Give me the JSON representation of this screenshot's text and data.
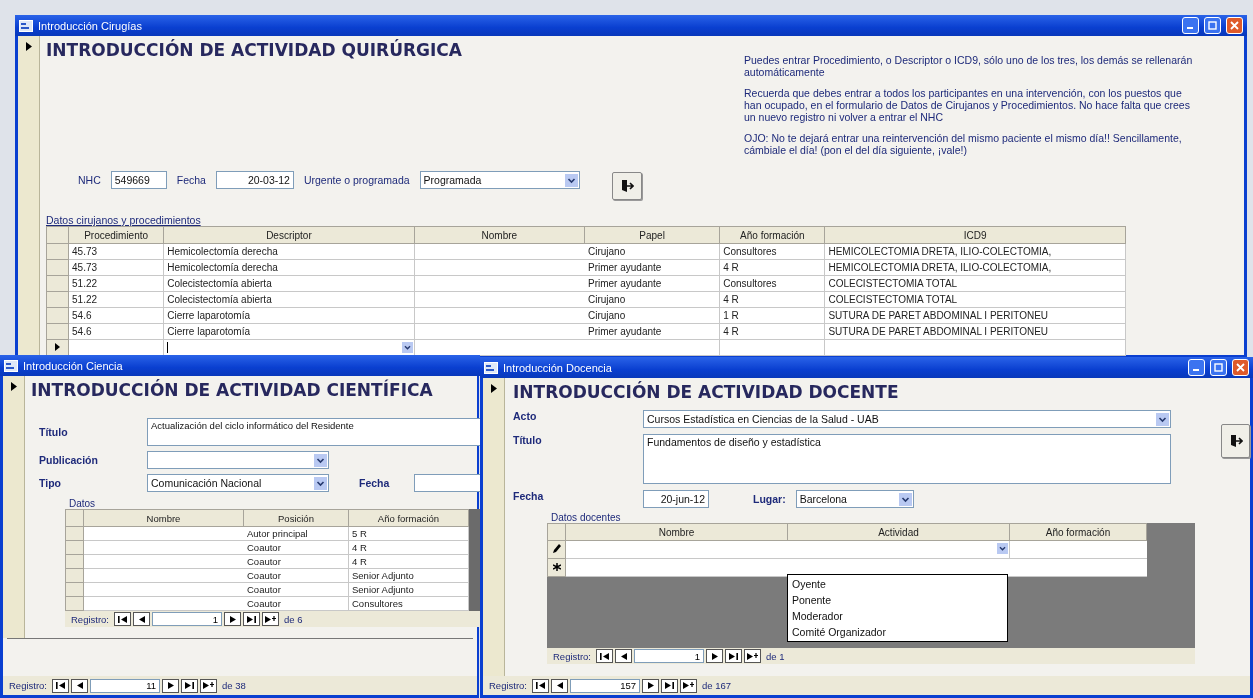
{
  "surgery_window": {
    "title": "Introducción Cirugías",
    "heading": "INTRODUCCIÓN DE ACTIVIDAD QUIRÚRGICA",
    "notes": [
      "Puedes entrar Procedimiento, o Descriptor o ICD9, sólo uno de los tres, los demás se rellenarán automáticamente",
      "Recuerda que debes entrar a todos los participantes en una intervención, con los puestos que han ocupado, en el formulario de Datos de Cirujanos y Procedimientos. No hace falta que crees un nuevo registro ni volver a entrar el NHC",
      "OJO: No te dejará entrar una reintervención del mismo paciente el mismo día!! Sencillamente, cámbiale el día! (pon el del día siguiente, ¡vale!)"
    ],
    "nhc_label": "NHC",
    "nhc": "549669",
    "date_label": "Fecha",
    "date": "20-03-12",
    "priority_label": "Urgente o programada",
    "priority": "Programada",
    "subform_label": "Datos cirujanos y procedimientos",
    "columns": [
      "Procedimiento",
      "Descriptor",
      "Nombre",
      "Papel",
      "Año formación",
      "ICD9"
    ],
    "rows": [
      {
        "procedure": "45.73",
        "descriptor": "Hemicolectomía derecha",
        "role": "Cirujano",
        "training": "Consultores",
        "icd9": "HEMICOLECTOMIA DRETA, ILIO-COLECTOMIA,"
      },
      {
        "procedure": "45.73",
        "descriptor": "Hemicolectomía derecha",
        "role": "Primer ayudante",
        "training": "4 R",
        "icd9": "HEMICOLECTOMIA DRETA, ILIO-COLECTOMIA,"
      },
      {
        "procedure": "51.22",
        "descriptor": "Colecistectomía abierta",
        "role": "Primer ayudante",
        "training": "Consultores",
        "icd9": "COLECISTECTOMIA TOTAL"
      },
      {
        "procedure": "51.22",
        "descriptor": "Colecistectomía abierta",
        "role": "Cirujano",
        "training": "4 R",
        "icd9": "COLECISTECTOMIA TOTAL"
      },
      {
        "procedure": "54.6",
        "descriptor": "Cierre laparotomía",
        "role": "Cirujano",
        "training": "1 R",
        "icd9": "SUTURA DE PARET ABDOMINAL I PERITONEU"
      },
      {
        "procedure": "54.6",
        "descriptor": "Cierre laparotomía",
        "role": "Primer ayudante",
        "training": "4 R",
        "icd9": "SUTURA DE PARET ABDOMINAL I PERITONEU"
      }
    ]
  },
  "science_window": {
    "title": "Introducción Ciencia",
    "heading": "INTRODUCCIÓN DE ACTIVIDAD CIENTÍFICA",
    "title_label": "Título",
    "title_value": "Actualización del ciclo informático del Residente",
    "publication_label": "Publicación",
    "type_label": "Tipo",
    "type": "Comunicación Nacional",
    "date_label": "Fecha",
    "subform_label": "Datos",
    "columns": [
      "Nombre",
      "Posición",
      "Año formación"
    ],
    "rows": [
      {
        "position": "Autor principal",
        "training": "5 R"
      },
      {
        "position": "Coautor",
        "training": "4 R"
      },
      {
        "position": "Coautor",
        "training": "4 R"
      },
      {
        "position": "Coautor",
        "training": "Senior Adjunto"
      },
      {
        "position": "Coautor",
        "training": "Senior Adjunto"
      },
      {
        "position": "Coautor",
        "training": "Consultores"
      }
    ],
    "subform_nav": {
      "label": "Registro:",
      "current": "1",
      "total": "de 6"
    },
    "nav": {
      "label": "Registro:",
      "current": "11",
      "total": "de 38"
    }
  },
  "teaching_window": {
    "title": "Introducción Docencia",
    "heading": "INTRODUCCIÓN DE ACTIVIDAD DOCENTE",
    "act_label": "Acto",
    "act": "Cursos Estadística en Ciencias de la Salud - UAB",
    "title_label": "Título",
    "title_value": "Fundamentos de diseño y estadística",
    "date_label": "Fecha",
    "date": "20-jun-12",
    "place_label": "Lugar:",
    "place": "Barcelona",
    "subform_label": "Datos docentes",
    "columns": [
      "Nombre",
      "Actividad",
      "Año formación"
    ],
    "rows": [
      {
        "kind": "editing"
      },
      {
        "kind": "new"
      }
    ],
    "dropdown": [
      "Oyente",
      "Ponente",
      "Moderador",
      "Comité Organizador"
    ],
    "subform_nav": {
      "label": "Registro:",
      "current": "1",
      "total": "de 1"
    },
    "nav": {
      "label": "Registro:",
      "current": "157",
      "total": "de 167"
    }
  }
}
